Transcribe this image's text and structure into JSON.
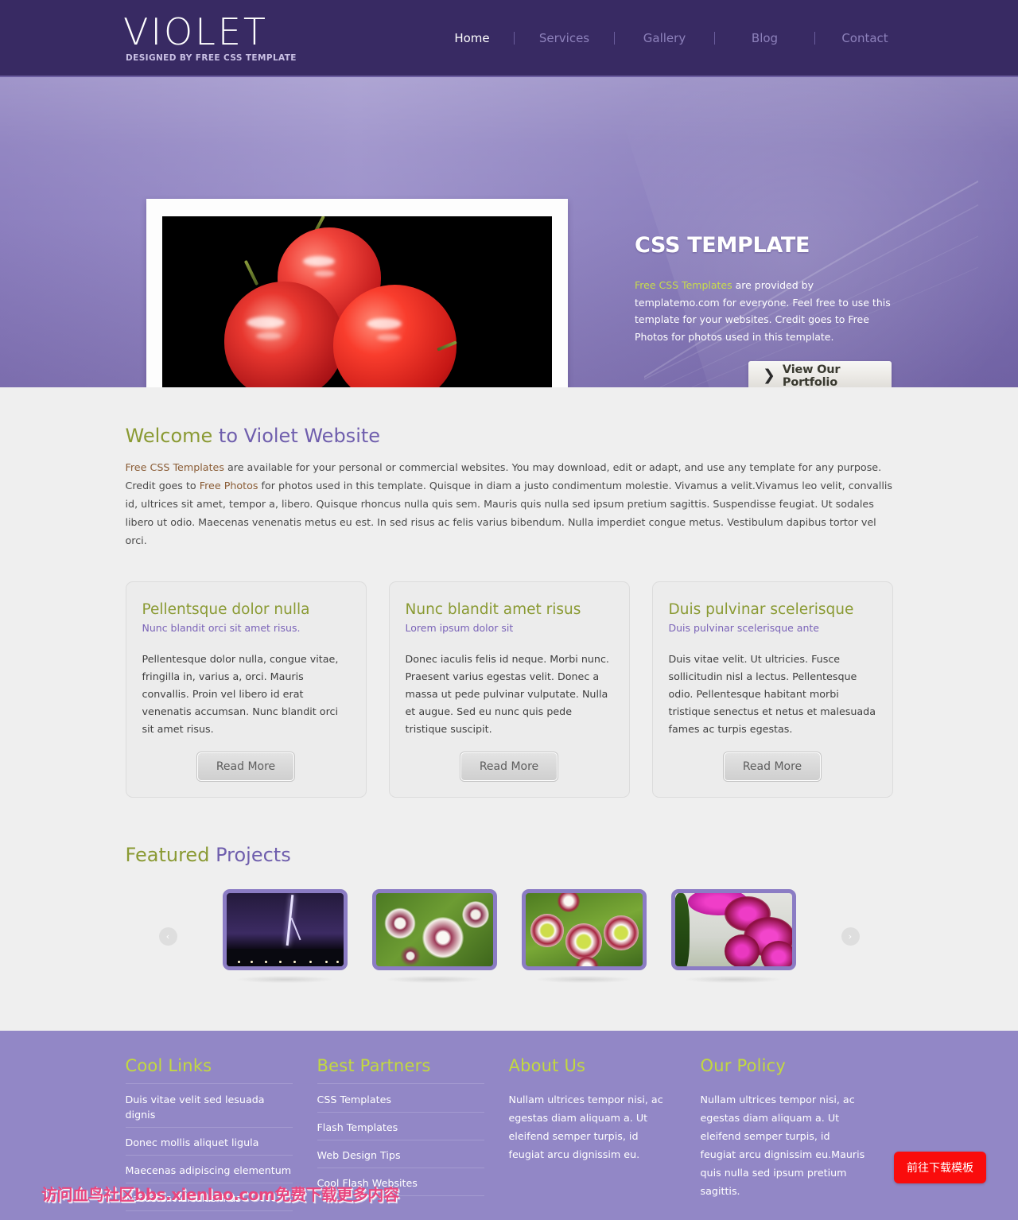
{
  "header": {
    "logo_title": "VIOLET",
    "logo_sub": "DESIGNED BY FREE CSS TEMPLATE",
    "nav": [
      {
        "label": "Home",
        "active": true
      },
      {
        "label": "Services",
        "active": false
      },
      {
        "label": "Gallery",
        "active": false
      },
      {
        "label": "Blog",
        "active": false
      },
      {
        "label": "Contact",
        "active": false
      }
    ]
  },
  "banner": {
    "image_alt": "three-red-apples-on-black-background",
    "heading": "CSS TEMPLATE",
    "link_text": "Free CSS Templates",
    "paragraph": " are provided by templatemo.com for everyone. Feel free to use this template for your websites. Credit goes to Free Photos for photos used in this template.",
    "button_label": "View Our Portfolio",
    "button_icon": "chevron-right-icon"
  },
  "welcome": {
    "title_green": "Welcome",
    "title_purple": "to Violet Website",
    "link1": "Free CSS Templates",
    "text1": " are available for your personal or commercial websites. You may download, edit or adapt, and use any template for any purpose. Credit goes to ",
    "link2": "Free Photos",
    "text2": " for photos used in this template. Quisque in diam a justo condimentum molestie. Vivamus a velit.Vivamus leo velit, convallis id, ultrices sit amet, tempor a, libero. Quisque rhoncus nulla quis sem. Mauris quis nulla sed ipsum pretium sagittis. Suspendisse feugiat. Ut sodales libero ut odio. Maecenas venenatis metus eu est. In sed risus ac felis varius bibendum. Nulla imperdiet congue metus. Vestibulum dapibus tortor vel orci."
  },
  "boxes": [
    {
      "title": "Pellentsque dolor nulla",
      "subtitle": "Nunc blandit orci sit amet risus.",
      "body": "Pellentesque dolor nulla, congue vitae, fringilla in, varius a, orci. Mauris convallis. Proin vel libero id erat venenatis accumsan. Nunc blandit orci sit amet risus.",
      "button": "Read More"
    },
    {
      "title": "Nunc blandit amet risus",
      "subtitle": "Lorem ipsum dolor sit",
      "body": "Donec iaculis felis id neque. Morbi nunc. Praesent varius egestas velit. Donec a massa ut pede pulvinar vulputate. Nulla et augue. Sed eu nunc quis pede tristique suscipit.",
      "button": "Read More"
    },
    {
      "title": "Duis pulvinar scelerisque",
      "subtitle": "Duis pulvinar scelerisque ante",
      "body": "Duis vitae velit. Ut ultricies. Fusce sollicitudin nisl a lectus. Pellentesque odio. Pellentesque habitant morbi tristique senectus et netus et malesuada fames ac turpis egestas.",
      "button": "Read More"
    }
  ],
  "featured": {
    "title_green": "Featured",
    "title_purple": "Projects",
    "prev_icon": "chevron-left-icon",
    "next_icon": "chevron-right-icon",
    "prev_glyph": "‹",
    "next_glyph": "›",
    "thumbs": [
      {
        "alt": "lightning-storm-over-city"
      },
      {
        "alt": "white-purple-daisy-flowers"
      },
      {
        "alt": "red-white-gazania-flowers"
      },
      {
        "alt": "pink-orchid-flowers"
      }
    ]
  },
  "footer": {
    "columns": [
      {
        "heading": "Cool Links",
        "links": [
          "Duis vitae velit sed lesuada dignis",
          "Donec mollis aliquet ligula",
          "Maecenas adipiscing elementum",
          "Nascetur ridiculus mus"
        ]
      },
      {
        "heading": "Best Partners",
        "links": [
          "CSS Templates",
          "Flash Templates",
          "Web Design Tips",
          "Cool Flash Websites"
        ]
      },
      {
        "heading": "About Us",
        "text": "Nullam ultrices tempor nisi, ac egestas diam aliquam a. Ut eleifend semper turpis, id feugiat arcu dignissim eu."
      },
      {
        "heading": "Our Policy",
        "text": "Nullam ultrices tempor nisi, ac egestas diam aliquam a. Ut eleifend semper turpis, id feugiat arcu dignissim eu.Mauris quis nulla sed ipsum pretium sagittis."
      }
    ],
    "watermark": "访问血鸟社区bbs.xienlao.com免费下载更多内容",
    "download_button": "前往下载模板"
  },
  "colors": {
    "header_bg": "#382a63",
    "banner_purple": "#9287c6",
    "accent_green": "#8a9a33",
    "footer_green": "#c3d93f",
    "accent_purple": "#6f5ead",
    "link_brown": "#8a5c35",
    "main_bg": "#efefef",
    "download_red": "#fa0c0c",
    "watermark_pink": "#e8467f"
  }
}
